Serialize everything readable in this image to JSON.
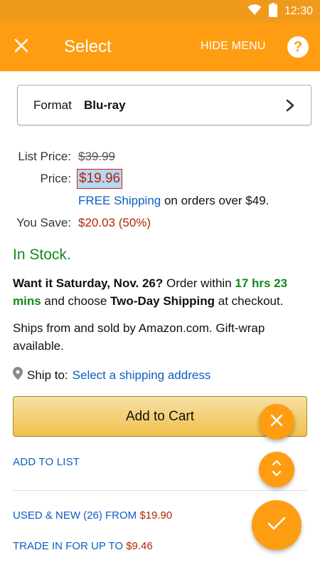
{
  "status_bar": {
    "time": "12:30",
    "icons": [
      "wifi-icon",
      "battery-icon"
    ]
  },
  "app_bar": {
    "title": "Select",
    "hide_menu_label": "HIDE MENU",
    "help_label": "?"
  },
  "format": {
    "label": "Format",
    "value": "Blu-ray"
  },
  "pricing": {
    "list_price_label": "List Price:",
    "list_price": "$39.99",
    "price_label": "Price:",
    "price": "$19.96",
    "free_shipping_link": "FREE Shipping",
    "free_shipping_text": " on orders over $49.",
    "you_save_label": "You Save:",
    "you_save": "$20.03 (50%)"
  },
  "stock": {
    "status": "In Stock."
  },
  "delivery": {
    "want_it": "Want it Saturday, Nov. 26?",
    "order_within": " Order within ",
    "time_left": "17 hrs 23 mins",
    "and_choose": " and choose ",
    "shipping_method": "Two-Day Shipping",
    "at_checkout": " at checkout."
  },
  "ships_from": "Ships from and sold by Amazon.com. Gift-wrap available.",
  "ship_to": {
    "label": "Ship to:",
    "link": "Select a shipping address"
  },
  "buttons": {
    "add_to_cart": "Add to Cart",
    "add_to_list": "ADD TO LIST"
  },
  "offers": {
    "used_new_label": "USED & NEW (26) FROM ",
    "used_new_price": "$19.90",
    "trade_in_label": "TRADE IN FOR UP TO ",
    "trade_in_price": "$9.46"
  },
  "colors": {
    "app_bar": "#ff9d12",
    "status_bar": "#f09a1b",
    "price_red": "#b12704",
    "stock_green": "#138a1a",
    "link_blue": "#0d5ec2"
  }
}
